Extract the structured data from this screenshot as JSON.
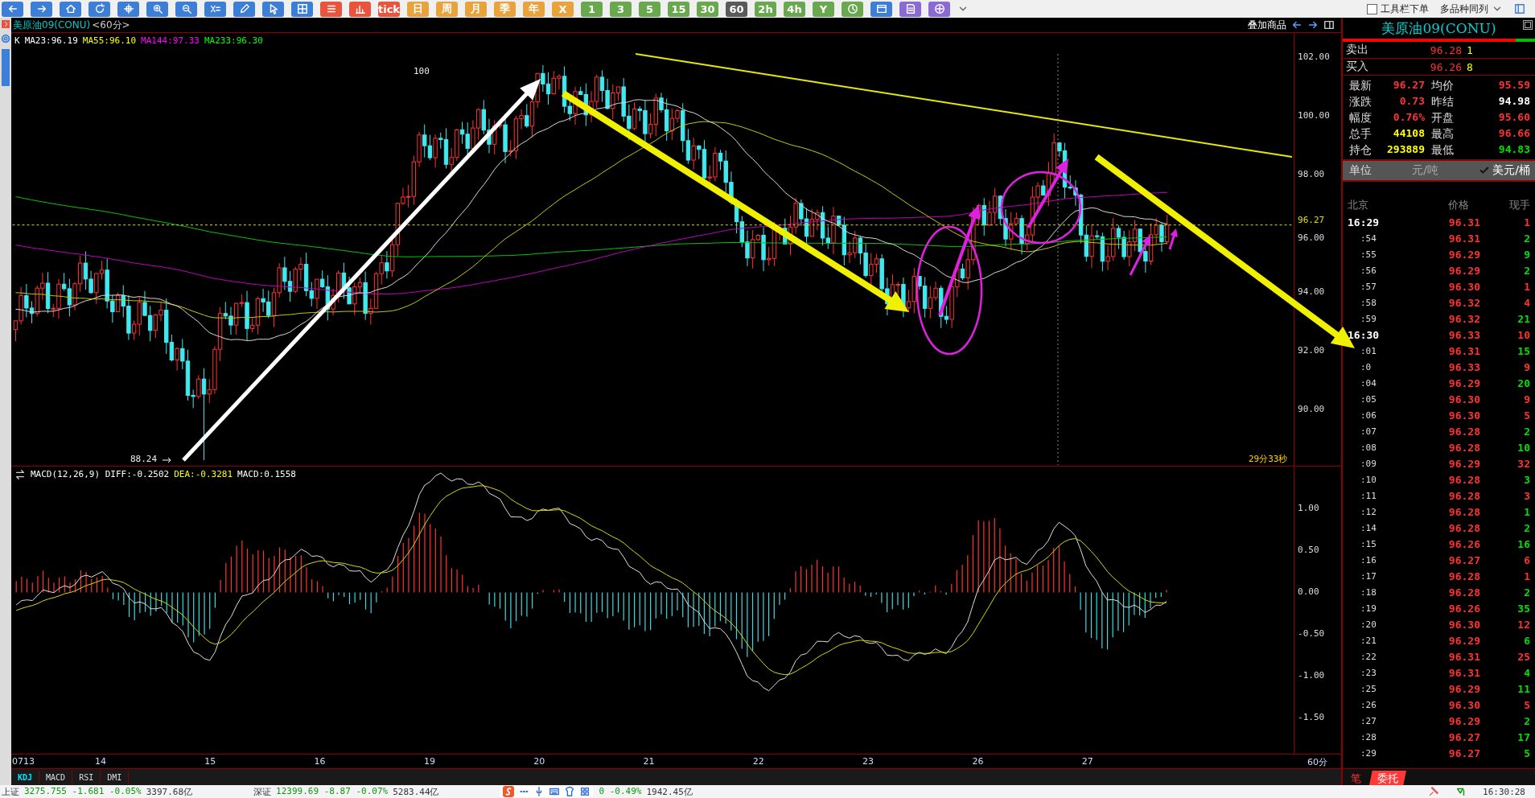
{
  "toolbar": {
    "buttons": [
      {
        "kind": "nav_icon",
        "selected": false
      },
      {
        "kind": "nav_icon",
        "selected": false
      },
      {
        "kind": "nav_icon",
        "selected": false
      },
      {
        "kind": "nav_icon",
        "selected": false
      },
      {
        "kind": "nav_icon",
        "selected": false
      },
      {
        "kind": "nav_icon",
        "selected": false
      },
      {
        "kind": "nav_icon",
        "selected": false
      },
      {
        "kind": "nav_icon",
        "selected": false
      },
      {
        "kind": "nav_icon",
        "selected": false
      },
      {
        "kind": "nav_icon",
        "selected": false
      },
      {
        "kind": "nav_icon",
        "selected": false
      },
      {
        "kind": "view_icon",
        "selected": false
      },
      {
        "kind": "view_icon",
        "selected": false
      },
      {
        "kind": "view_text",
        "label": "tick",
        "selected": false
      },
      {
        "kind": "date_text",
        "label": "日",
        "selected": false
      },
      {
        "kind": "date_text",
        "label": "周",
        "selected": false
      },
      {
        "kind": "date_text",
        "label": "月",
        "selected": false
      },
      {
        "kind": "date_text",
        "label": "季",
        "selected": false
      },
      {
        "kind": "date_text",
        "label": "年",
        "selected": false
      },
      {
        "kind": "date_text",
        "label": "X",
        "selected": false
      },
      {
        "kind": "minute_text",
        "label": "1",
        "selected": false
      },
      {
        "kind": "minute_text",
        "label": "3",
        "selected": false
      },
      {
        "kind": "minute_text",
        "label": "5",
        "selected": false
      },
      {
        "kind": "minute_text",
        "label": "15",
        "selected": false
      },
      {
        "kind": "minute_text",
        "label": "30",
        "selected": false
      },
      {
        "kind": "minute_text",
        "label": "60",
        "selected": true
      },
      {
        "kind": "minute_text",
        "label": "2h",
        "selected": false
      },
      {
        "kind": "minute_text",
        "label": "4h",
        "selected": false
      },
      {
        "kind": "minute_text",
        "label": "Y",
        "selected": false
      },
      {
        "kind": "minute_icon",
        "selected": false
      },
      {
        "kind": "nav_icon",
        "selected": false
      },
      {
        "kind": "tool_icon",
        "selected": false
      },
      {
        "kind": "tool_icon",
        "selected": false
      }
    ],
    "order_toolbar": {
      "label": "工具栏下单",
      "checked": false
    },
    "multi_view": {
      "label": "多品种同列"
    }
  },
  "chart": {
    "title": "美原油09(CONU)",
    "period": "<60分>",
    "overlay_button": "叠加商品",
    "legend": [
      {
        "label": "K",
        "color": "#ffffff"
      },
      {
        "label": "MA23:96.19",
        "color": "#ffffff"
      },
      {
        "label": "MA55:96.10",
        "color": "#ffff00"
      },
      {
        "label": "MA144:97.33",
        "color": "#ff00ff"
      },
      {
        "label": "MA233:96.30",
        "color": "#00ff00"
      }
    ],
    "price_axis": [
      "102.00",
      "100.00",
      "98.00",
      "96.00",
      "94.00",
      "92.00",
      "90.00"
    ],
    "current_price": "96.27",
    "high_label": "100",
    "low_label": "88.24",
    "countdown": "29分33秒",
    "macd_legend": [
      {
        "text": "MACD(12,26,9) DIFF:-0.2502",
        "color": "#ffffff"
      },
      {
        "text": "DEA:-0.3281",
        "color": "#ffff00"
      },
      {
        "text": "MACD:0.1558",
        "color": "#ffffff"
      }
    ],
    "macd_axis": [
      "1.00",
      "0.50",
      "0.00",
      "-0.50",
      "-1.00",
      "-1.50"
    ],
    "time_axis": [
      "0713",
      "14",
      "15",
      "16",
      "19",
      "20",
      "21",
      "22",
      "23",
      "26",
      "27"
    ],
    "period_label": "60分",
    "indicator_tabs": [
      {
        "label": "KDJ",
        "selected": true
      },
      {
        "label": "MACD",
        "selected": false
      },
      {
        "label": "RSI",
        "selected": false
      },
      {
        "label": "DMI",
        "selected": false
      }
    ]
  },
  "quote_panel": {
    "title": "美原油09(CONU)",
    "bid_ask_bar": {
      "level": 0.9
    },
    "bid_ask": [
      {
        "label": "卖出",
        "price": "96.28",
        "volume": "1"
      },
      {
        "label": "买入",
        "price": "96.26",
        "volume": "8"
      }
    ],
    "stats": [
      {
        "label": "最新",
        "value": "96.27",
        "color": "#ff3232"
      },
      {
        "label": "均价",
        "value": "95.59",
        "color": "#ff3232"
      },
      {
        "label": "涨跌",
        "value": "0.73",
        "color": "#ff3232"
      },
      {
        "label": "昨结",
        "value": "94.98",
        "color": "#ffffff"
      },
      {
        "label": "幅度",
        "value": "0.76%",
        "color": "#ff3232"
      },
      {
        "label": "开盘",
        "value": "95.60",
        "color": "#ff3232"
      },
      {
        "label": "总手",
        "value": "44108",
        "color": "#ffff00"
      },
      {
        "label": "最高",
        "value": "96.66",
        "color": "#ff3232"
      },
      {
        "label": "持仓",
        "value": "293889",
        "color": "#ffff00"
      },
      {
        "label": "最低",
        "value": "94.83",
        "color": "#00e000"
      }
    ],
    "unit": {
      "label": "单位",
      "options": [
        {
          "label": "元/吨",
          "selected": false
        },
        {
          "label": "美元/桶",
          "selected": true
        }
      ]
    },
    "ticks_header": [
      "北京",
      "价格",
      "现手"
    ],
    "ticks": [
      {
        "time": "16:29",
        "kind": "full",
        "price": "96.31",
        "volume": "1",
        "color": "#ff3232"
      },
      {
        "time": ":54",
        "kind": "short",
        "price": "96.31",
        "volume": "2",
        "color": "#00e000"
      },
      {
        "time": ":55",
        "kind": "short",
        "price": "96.29",
        "volume": "9",
        "color": "#00e000"
      },
      {
        "time": ":56",
        "kind": "short",
        "price": "96.29",
        "volume": "2",
        "color": "#00e000"
      },
      {
        "time": ":57",
        "kind": "short",
        "price": "96.30",
        "volume": "1",
        "color": "#ff3232"
      },
      {
        "time": ":58",
        "kind": "short",
        "price": "96.32",
        "volume": "4",
        "color": "#ff3232"
      },
      {
        "time": ":59",
        "kind": "short",
        "price": "96.32",
        "volume": "21",
        "color": "#00e000"
      },
      {
        "time": "16:30",
        "kind": "full",
        "price": "96.33",
        "volume": "10",
        "color": "#ff3232"
      },
      {
        "time": ":01",
        "kind": "short",
        "price": "96.31",
        "volume": "15",
        "color": "#00e000"
      },
      {
        "time": ":0",
        "kind": "short",
        "price": "96.33",
        "volume": "9",
        "color": "#ff3232"
      },
      {
        "time": ":04",
        "kind": "short",
        "price": "96.29",
        "volume": "20",
        "color": "#00e000"
      },
      {
        "time": ":05",
        "kind": "short",
        "price": "96.30",
        "volume": "9",
        "color": "#ff3232"
      },
      {
        "time": ":06",
        "kind": "short",
        "price": "96.30",
        "volume": "5",
        "color": "#ff3232"
      },
      {
        "time": ":07",
        "kind": "short",
        "price": "96.28",
        "volume": "2",
        "color": "#00e000"
      },
      {
        "time": ":08",
        "kind": "short",
        "price": "96.28",
        "volume": "10",
        "color": "#00e000"
      },
      {
        "time": ":09",
        "kind": "short",
        "price": "96.29",
        "volume": "32",
        "color": "#ff3232"
      },
      {
        "time": ":10",
        "kind": "short",
        "price": "96.28",
        "volume": "3",
        "color": "#00e000"
      },
      {
        "time": ":11",
        "kind": "short",
        "price": "96.28",
        "volume": "3",
        "color": "#ff3232"
      },
      {
        "time": ":12",
        "kind": "short",
        "price": "96.28",
        "volume": "1",
        "color": "#00e000"
      },
      {
        "time": ":14",
        "kind": "short",
        "price": "96.28",
        "volume": "2",
        "color": "#00e000"
      },
      {
        "time": ":15",
        "kind": "short",
        "price": "96.26",
        "volume": "16",
        "color": "#00e000"
      },
      {
        "time": ":16",
        "kind": "short",
        "price": "96.27",
        "volume": "6",
        "color": "#ff3232"
      },
      {
        "time": ":17",
        "kind": "short",
        "price": "96.28",
        "volume": "1",
        "color": "#ff3232"
      },
      {
        "time": ":18",
        "kind": "short",
        "price": "96.28",
        "volume": "2",
        "color": "#00e000"
      },
      {
        "time": ":19",
        "kind": "short",
        "price": "96.26",
        "volume": "35",
        "color": "#00e000"
      },
      {
        "time": ":20",
        "kind": "short",
        "price": "96.30",
        "volume": "12",
        "color": "#ff3232"
      },
      {
        "time": ":21",
        "kind": "short",
        "price": "96.29",
        "volume": "6",
        "color": "#00e000"
      },
      {
        "time": ":22",
        "kind": "short",
        "price": "96.31",
        "volume": "25",
        "color": "#ff3232"
      },
      {
        "time": ":23",
        "kind": "short",
        "price": "96.31",
        "volume": "4",
        "color": "#00e000"
      },
      {
        "time": ":25",
        "kind": "short",
        "price": "96.29",
        "volume": "11",
        "color": "#00e000"
      },
      {
        "time": ":26",
        "kind": "short",
        "price": "96.30",
        "volume": "5",
        "color": "#ff3232"
      },
      {
        "time": ":27",
        "kind": "short",
        "price": "96.29",
        "volume": "2",
        "color": "#00e000"
      },
      {
        "time": ":28",
        "kind": "short",
        "price": "96.27",
        "volume": "17",
        "color": "#00e000"
      },
      {
        "time": ":29",
        "kind": "short",
        "price": "96.27",
        "volume": "5",
        "color": "#00e000"
      }
    ],
    "tabs": [
      {
        "label": "笔",
        "selected": false
      },
      {
        "label": "委托",
        "selected": true
      }
    ]
  },
  "status_bar": {
    "indices": [
      {
        "name": "上证",
        "values": "3275.755 -1.681 -0.05%",
        "turnover": "3397.68亿"
      },
      {
        "name": "深证",
        "values": "12399.69 -8.87 -0.07%",
        "turnover": "5283.44亿"
      },
      {
        "values": "0 -0.49%",
        "turnover": "1942.45亿"
      }
    ],
    "time": "16:30:28"
  }
}
